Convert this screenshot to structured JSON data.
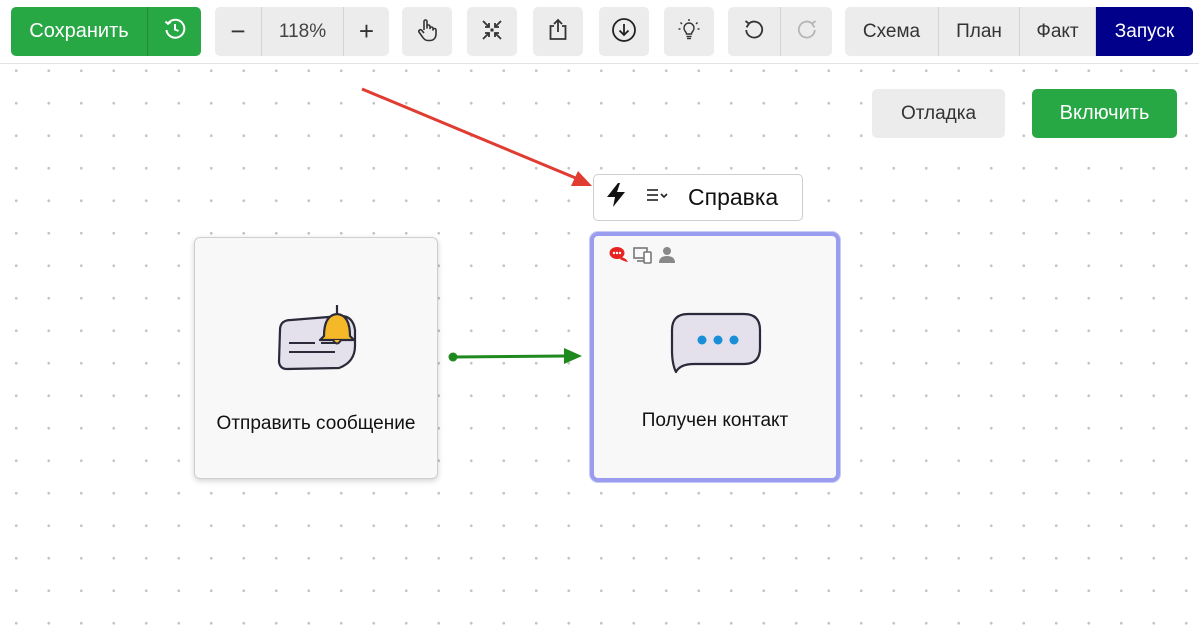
{
  "toolbar": {
    "save_label": "Сохранить",
    "zoom_value": "118%",
    "zoom_minus": "−",
    "zoom_plus": "+",
    "tabs": [
      "Схема",
      "План",
      "Факт",
      "Запуск"
    ],
    "active_tab": "Запуск",
    "icons": [
      "history-icon",
      "hand-pointer-icon",
      "collapse-icon",
      "share-icon",
      "download-icon",
      "lightbulb-icon",
      "undo-icon",
      "redo-icon"
    ]
  },
  "actions": {
    "debug_label": "Отладка",
    "enable_label": "Включить"
  },
  "node_toolbar": {
    "help_label": "Справка",
    "icons": [
      "lightning-icon",
      "list-menu-icon"
    ]
  },
  "nodes": [
    {
      "label": "Отправить сообщение",
      "icon": "message-bell-icon"
    },
    {
      "label": "Получен контакт",
      "icon": "chat-bubble-dots-icon",
      "selected": true,
      "badges": [
        "chat-red-icon",
        "devices-icon",
        "person-icon"
      ]
    }
  ],
  "colors": {
    "save_green": "#28a745",
    "run_tab": "#00008b",
    "selection": "#9a9cf0",
    "connector": "#1e8a1e",
    "annotation_arrow": "#e03c31"
  }
}
